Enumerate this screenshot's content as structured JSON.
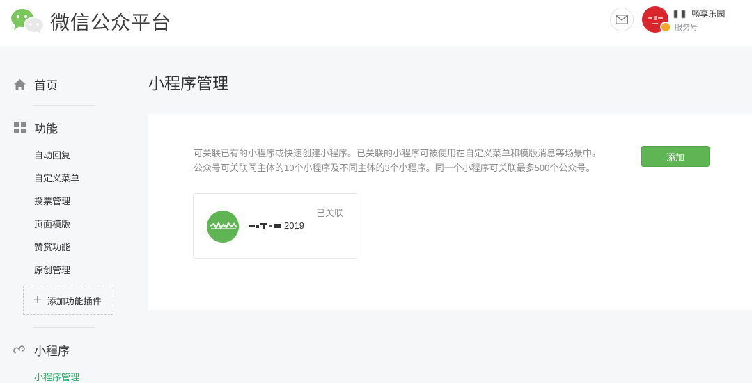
{
  "header": {
    "brand": "微信公众平台",
    "account_name": "深畅享乐园",
    "account_name_visible": " 畅享乐园",
    "account_type": "服务号",
    "icons": [
      "wechat-logo-icon",
      "mail-icon",
      "verified-badge-icon"
    ]
  },
  "sidebar": {
    "home": "首页",
    "features": "功能",
    "feature_items": [
      "自动回复",
      "自定义菜单",
      "投票管理",
      "页面模版",
      "赞赏功能",
      "原创管理"
    ],
    "add_plugin": "添加功能插件",
    "mini_program": "小程序",
    "cut_item": "小程序管理"
  },
  "main": {
    "title": "小程序管理",
    "description_line1": "可关联已有的小程序或快速创建小程序。已关联的小程序可被使用在自定义菜单和模版消息等场景中。",
    "description_line2": "公众号可关联同主体的10个小程序及不同主体的3个小程序。同一个小程序可关联最多500个公众号。",
    "add_button": "添加",
    "card": {
      "status": "已关联",
      "name_suffix": "2019"
    }
  },
  "colors": {
    "accent_green": "#5fb554",
    "avatar_red": "#d9262c",
    "page_bg": "#f6f7f8"
  }
}
